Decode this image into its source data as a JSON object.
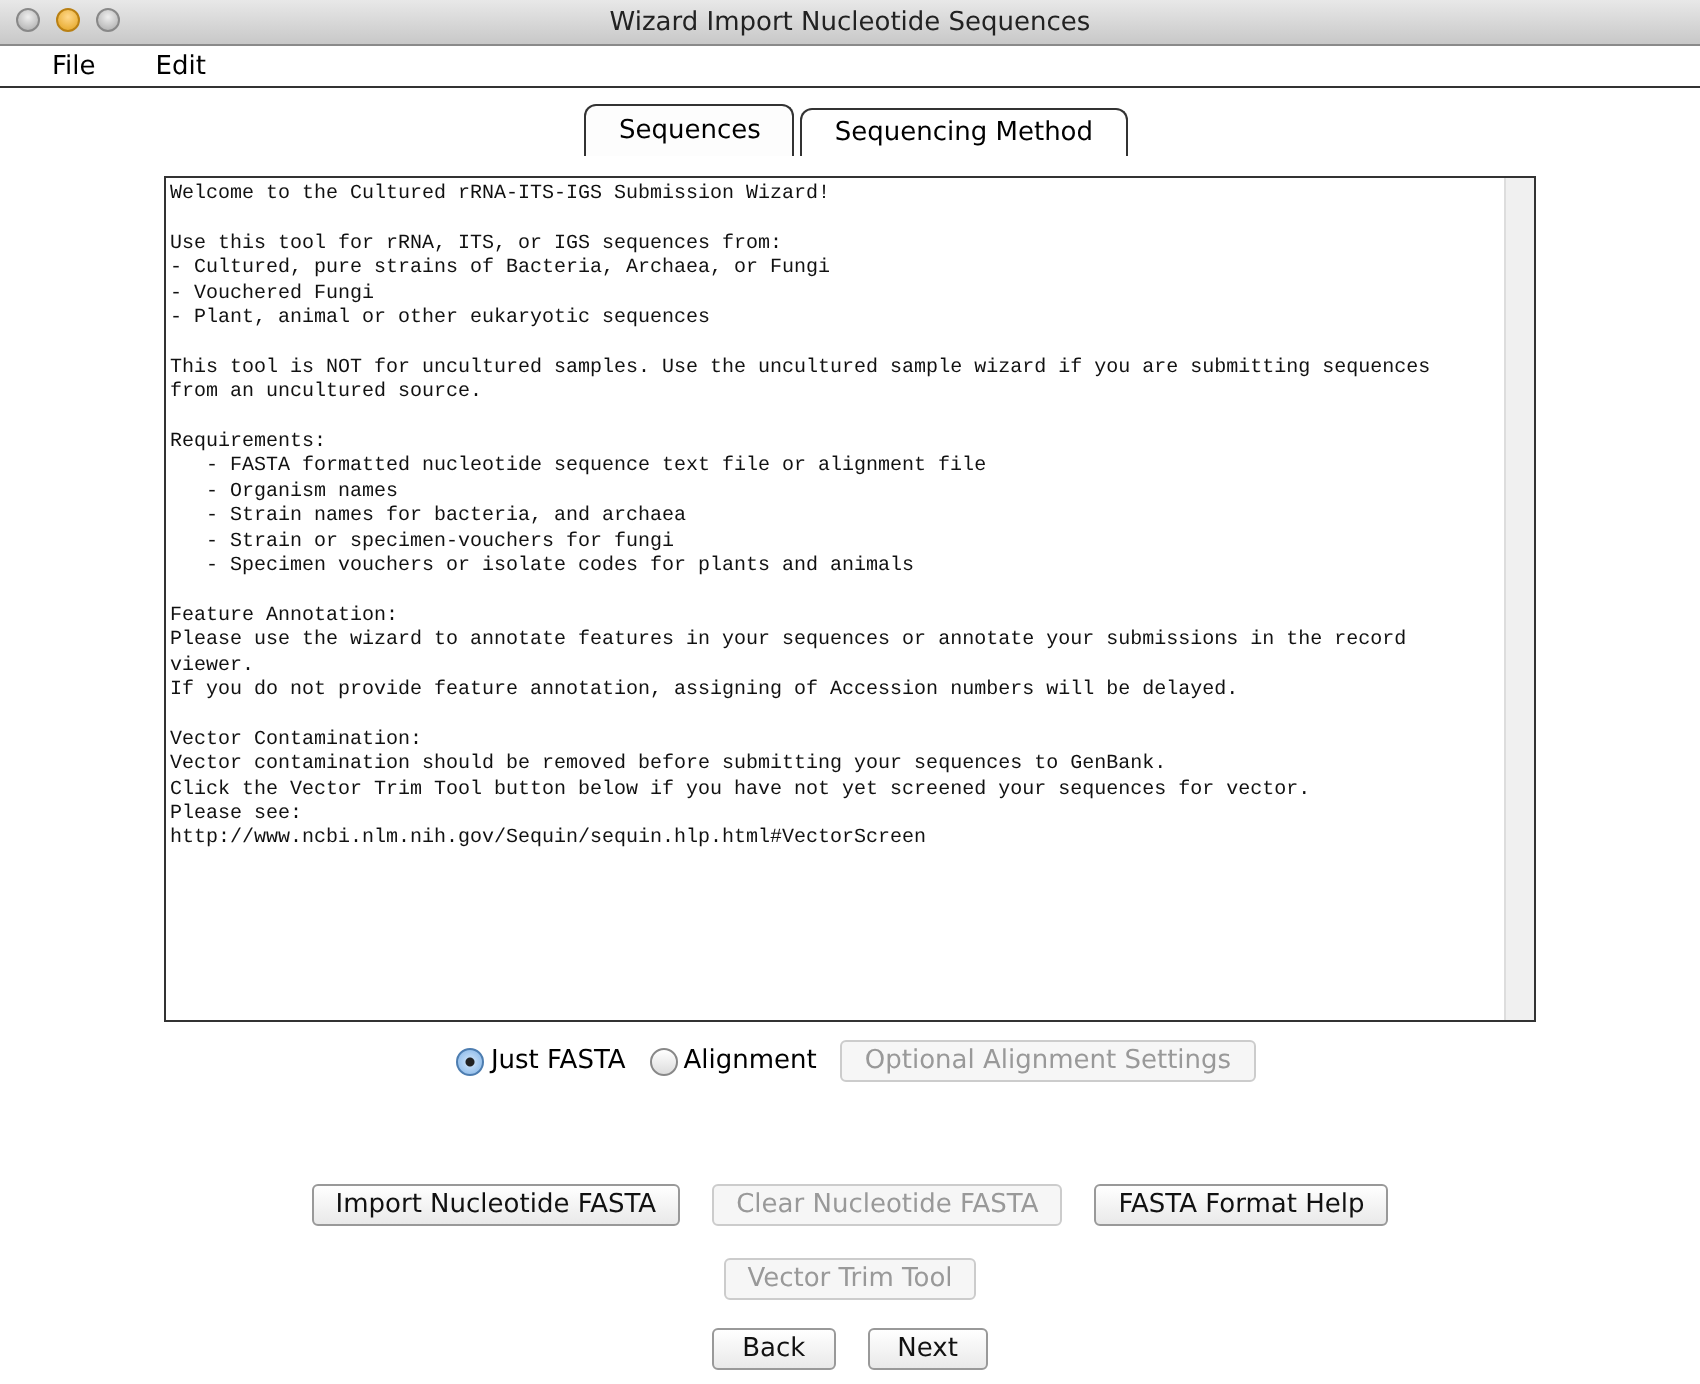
{
  "window": {
    "title": "Wizard Import Nucleotide Sequences"
  },
  "menu": [
    "File",
    "Edit"
  ],
  "tabs": [
    {
      "label": "Sequences",
      "selected": true
    },
    {
      "label": "Sequencing Method",
      "selected": false
    }
  ],
  "text_area": {
    "paragraphs": [
      [
        {
          "kind": "plain",
          "text": "Welcome to the Cultured rRNA-ITS-IGS Submission Wizard!"
        }
      ],
      [
        {
          "kind": "plain",
          "text": "Use this tool for rRNA, ITS, or IGS sequences from:"
        },
        {
          "kind": "plain",
          "text": "- Cultured, pure strains of Bacteria, Archaea, or Fungi"
        },
        {
          "kind": "plain",
          "text": "- Vouchered Fungi"
        },
        {
          "kind": "plain",
          "text": "- Plant, animal or other eukaryotic sequences"
        }
      ],
      [
        {
          "kind": "plain",
          "text": "This tool is NOT for uncultured samples. Use the uncultured sample wizard if you are submitting sequences"
        },
        {
          "kind": "plain",
          "text": "from an uncultured source."
        }
      ],
      [
        {
          "kind": "plain",
          "text": "Requirements:"
        },
        {
          "kind": "indented",
          "text": "- FASTA formatted nucleotide sequence text file or alignment file"
        },
        {
          "kind": "indented",
          "text": "- Organism names"
        },
        {
          "kind": "indented",
          "text": "- Strain names for bacteria, and archaea"
        },
        {
          "kind": "indented",
          "text": "- Strain or specimen-vouchers for fungi"
        },
        {
          "kind": "indented",
          "text": "- Specimen vouchers or isolate codes for plants and animals"
        }
      ],
      [
        {
          "kind": "plain",
          "text": "Feature Annotation:"
        },
        {
          "kind": "plain",
          "text": "Please use the wizard to annotate features in your sequences or annotate your submissions in the record"
        },
        {
          "kind": "plain",
          "text": "viewer."
        },
        {
          "kind": "plain",
          "text": "If you do not provide feature annotation, assigning of Accession numbers will be delayed."
        }
      ],
      [
        {
          "kind": "plain",
          "text": "Vector Contamination:"
        },
        {
          "kind": "plain",
          "text": "Vector contamination should be removed before submitting your sequences to GenBank."
        },
        {
          "kind": "plain",
          "text": "Click the Vector Trim Tool button below if you have not yet screened your sequences for vector."
        },
        {
          "kind": "plain",
          "text": "Please see:"
        },
        {
          "kind": "plain",
          "text": "http://www.ncbi.nlm.nih.gov/Sequin/sequin.hlp.html#VectorScreen"
        }
      ]
    ]
  },
  "format_options": [
    {
      "label": "Just FASTA",
      "selected": true
    },
    {
      "label": "Alignment",
      "selected": false
    }
  ],
  "alignment_settings_button": {
    "label": "Optional Alignment Settings",
    "disabled": true
  },
  "action_buttons": [
    {
      "label": "Import Nucleotide FASTA",
      "disabled": false
    },
    {
      "label": "Clear Nucleotide FASTA",
      "disabled": true
    },
    {
      "label": "FASTA Format Help",
      "disabled": false
    }
  ],
  "vector_trim_button": {
    "label": "Vector Trim Tool",
    "disabled": true
  },
  "nav_buttons": [
    {
      "label": "Back",
      "disabled": false
    },
    {
      "label": "Next",
      "disabled": false
    }
  ]
}
